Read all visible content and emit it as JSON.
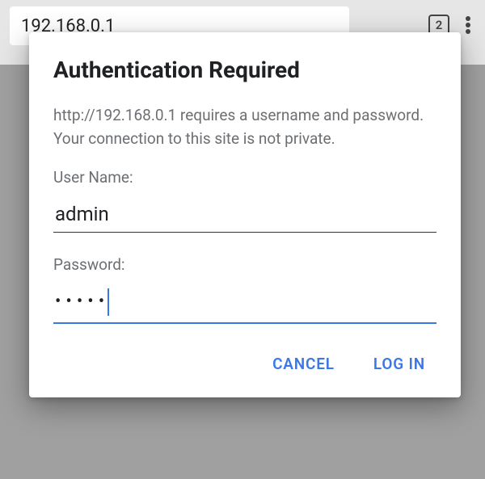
{
  "browser": {
    "url_text": "192.168.0.1",
    "tab_count": "2"
  },
  "dialog": {
    "title": "Authentication Required",
    "message": "http://192.168.0.1 requires a username and password. Your connection to this site is not private.",
    "username_label": "User Name:",
    "username_value": "admin",
    "password_label": "Password:",
    "password_mask": "•••••",
    "cancel_label": "CANCEL",
    "login_label": "LOG IN"
  }
}
